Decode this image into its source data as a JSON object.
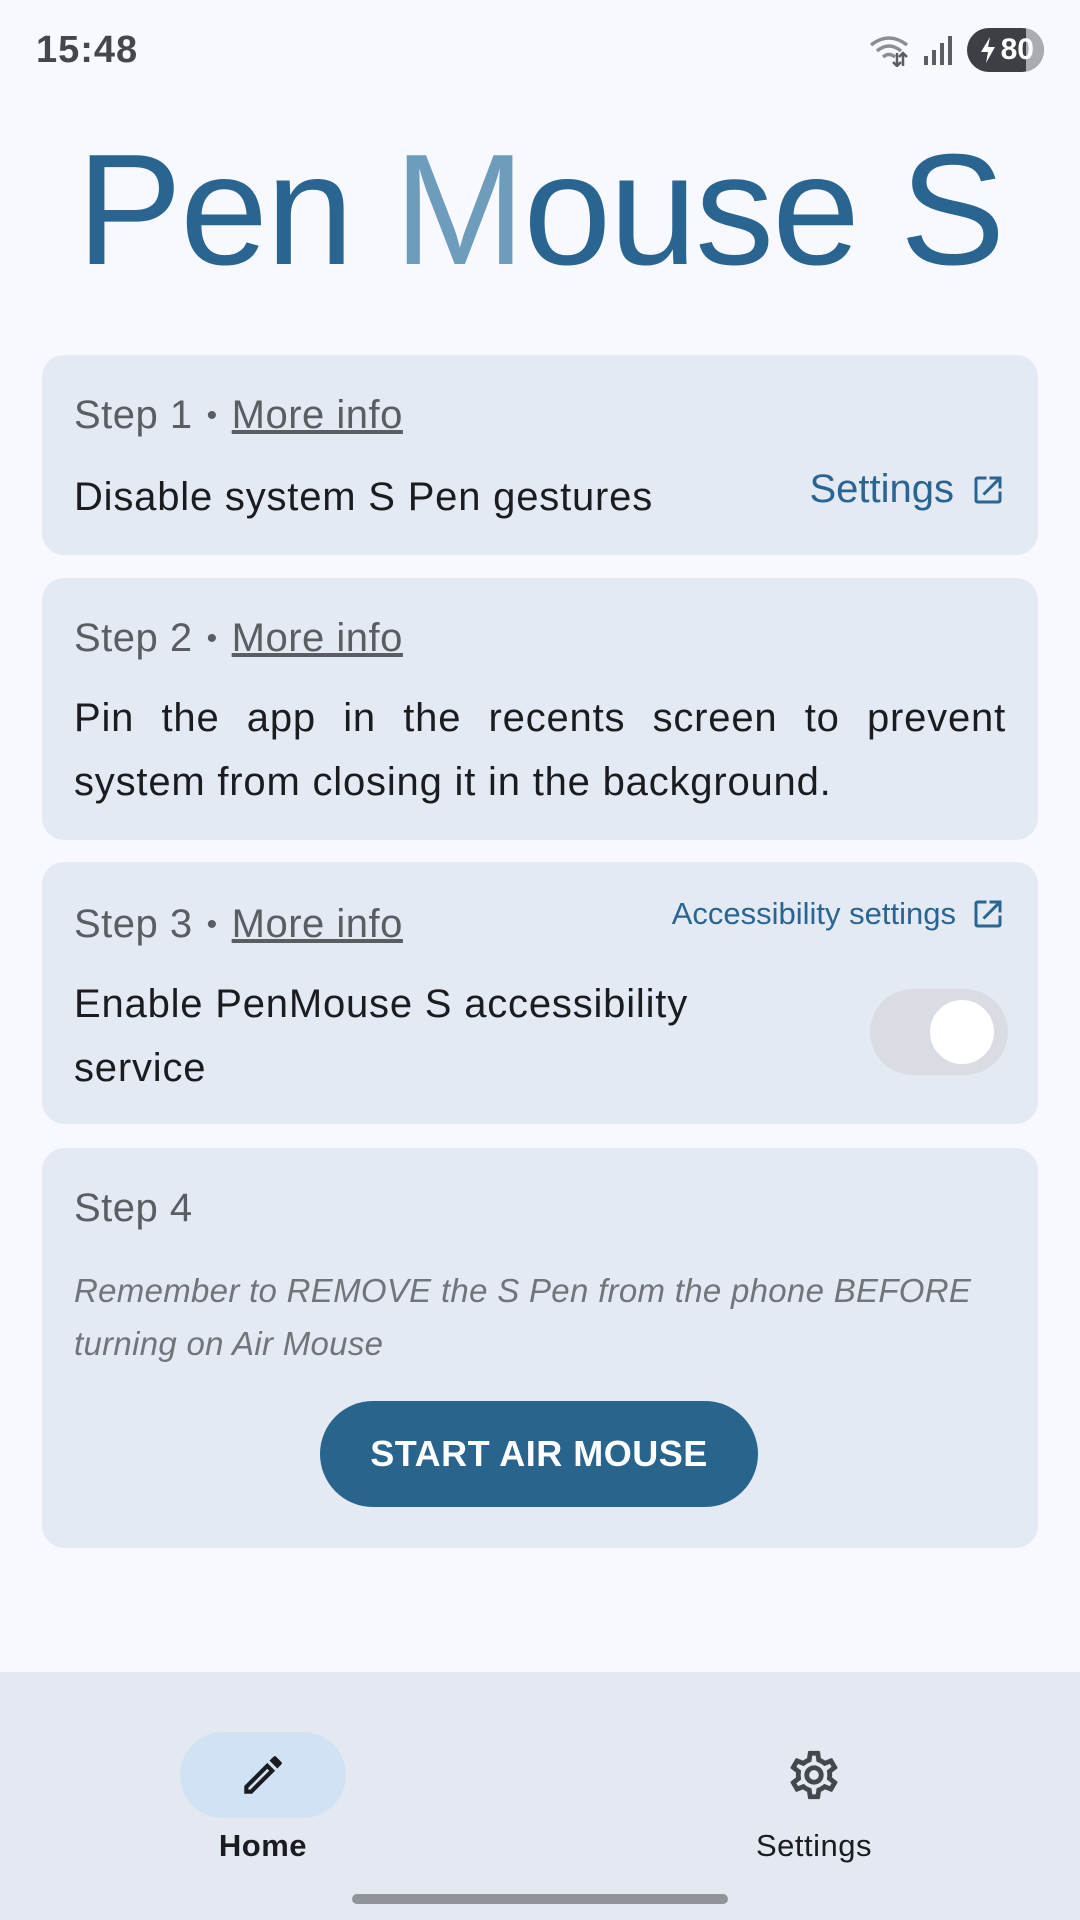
{
  "status_bar": {
    "time": "15:48",
    "battery_level": "80",
    "icons": [
      "wifi-icon",
      "signal-icon",
      "battery-charging-icon"
    ]
  },
  "app": {
    "logo_part1": "Pen ",
    "logo_m": "M",
    "logo_part2": "ouse S"
  },
  "steps": [
    {
      "label": "Step 1",
      "separator": "•",
      "more_info": "More info",
      "text": "Disable system S Pen gestures",
      "action_label": "Settings"
    },
    {
      "label": "Step 2",
      "separator": "•",
      "more_info": "More info",
      "text_line1": "Pin the app in the recents screen to prevent",
      "text_line2": "system from closing it in the background."
    },
    {
      "label": "Step 3",
      "separator": "•",
      "more_info": "More info",
      "action_label": "Accessibility settings",
      "text_line1": "Enable PenMouse S accessibility",
      "text_line2": "service",
      "toggle_on": false
    },
    {
      "label": "Step 4",
      "note_line1": "Remember to REMOVE the S Pen from the phone BEFORE",
      "note_line2": "turning on Air Mouse",
      "button_label": "START AIR MOUSE"
    }
  ],
  "bottom_nav": {
    "items": [
      {
        "label": "Home",
        "icon": "pencil-icon",
        "active": true
      },
      {
        "label": "Settings",
        "icon": "gear-icon",
        "active": false
      }
    ]
  },
  "colors": {
    "accent": "#29648c",
    "card_bg": "#e4eaf4",
    "page_bg": "#f7f9fe",
    "nav_active_pill": "#d0e2f4"
  }
}
